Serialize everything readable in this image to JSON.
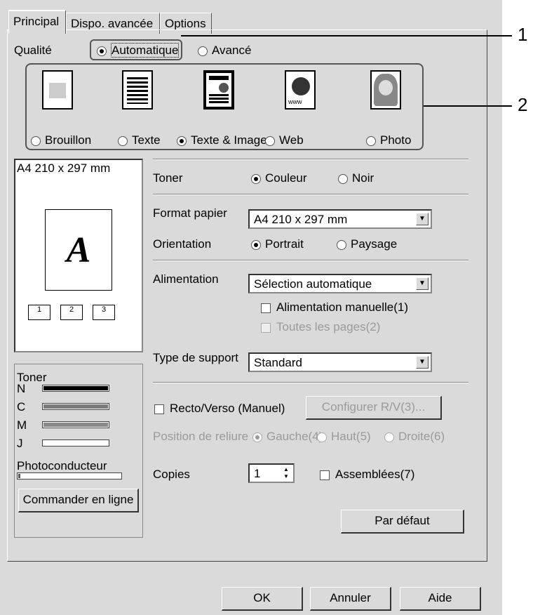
{
  "tabs": [
    "Principal",
    "Dispo. avancée",
    "Options"
  ],
  "quality": {
    "label": "Qualité",
    "modes": [
      "Automatique",
      "Avancé"
    ],
    "presets": [
      "Brouillon",
      "Texte",
      "Texte & Image",
      "Web",
      "Photo"
    ],
    "selected_preset": "Texte & Image"
  },
  "preview": {
    "paper_size": "A4 210 x 297 mm",
    "letter": "A",
    "copies_labels": [
      "1",
      "2",
      "3"
    ]
  },
  "settings": {
    "toner_label": "Toner",
    "toner_options": [
      "Couleur",
      "Noir"
    ],
    "paper_format_label": "Format papier",
    "paper_format_value": "A4 210 x 297 mm",
    "orientation_label": "Orientation",
    "orientation_options": [
      "Portrait",
      "Paysage"
    ],
    "source_label": "Alimentation",
    "source_value": "Sélection automatique",
    "manual_feed": "Alimentation manuelle(1)",
    "all_pages": "Toutes les pages(2)",
    "media_label": "Type de support",
    "media_value": "Standard",
    "duplex": "Recto/Verso (Manuel)",
    "duplex_button": "Configurer R/V(3)...",
    "binding_label": "Position de reliure",
    "binding_options": [
      "Gauche(4)",
      "Haut(5)",
      "Droite(6)"
    ],
    "copies_label": "Copies",
    "copies_value": "1",
    "collate": "Assemblées(7)",
    "default_button": "Par défaut"
  },
  "toner_levels": {
    "title": "Toner",
    "items": [
      {
        "name": "N",
        "level": 1.0,
        "color": "#000000"
      },
      {
        "name": "C",
        "level": 1.0,
        "color": "#7a7a7a"
      },
      {
        "name": "M",
        "level": 1.0,
        "color": "#8a8a8a"
      },
      {
        "name": "J",
        "level": 0.0,
        "color": "#bdbdbd"
      }
    ],
    "photoconductor_label": "Photoconducteur",
    "photoconductor_level": 0.02,
    "order_button": "Commander en ligne"
  },
  "dialog_buttons": [
    "OK",
    "Annuler",
    "Aide"
  ],
  "callouts": [
    "1",
    "2"
  ]
}
